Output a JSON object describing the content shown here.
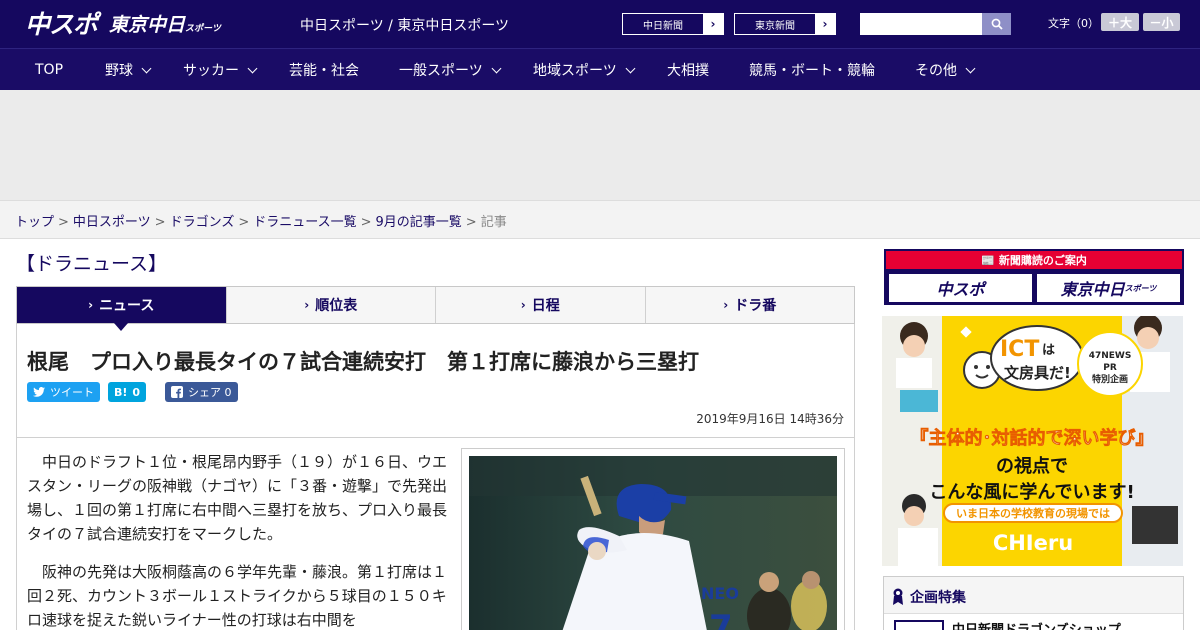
{
  "header": {
    "logo_main": "中スポ",
    "logo_sub": "東京中日",
    "logo_sub_small": "スポーツ",
    "site_title": "中日スポーツ / 東京中日スポーツ",
    "paper_links": [
      "中日新聞",
      "東京新聞"
    ],
    "search_placeholder": "",
    "font_size_label": "文字（0）",
    "font_bigger": "＋大",
    "font_smaller": "－小"
  },
  "nav": [
    {
      "label": "TOP",
      "dropdown": false
    },
    {
      "label": "野球",
      "dropdown": true
    },
    {
      "label": "サッカー",
      "dropdown": true
    },
    {
      "label": "芸能・社会",
      "dropdown": false
    },
    {
      "label": "一般スポーツ",
      "dropdown": true
    },
    {
      "label": "地域スポーツ",
      "dropdown": true
    },
    {
      "label": "大相撲",
      "dropdown": false
    },
    {
      "label": "競馬・ボート・競輪",
      "dropdown": false
    },
    {
      "label": "その他",
      "dropdown": true
    }
  ],
  "breadcrumb": {
    "items": [
      "トップ",
      "中日スポーツ",
      "ドラゴンズ",
      "ドラニュース一覧",
      "9月の記事一覧"
    ],
    "current": "記事"
  },
  "section_title": "【ドラニュース】",
  "tabs": [
    {
      "label": "ニュース",
      "active": true
    },
    {
      "label": "順位表",
      "active": false
    },
    {
      "label": "日程",
      "active": false
    },
    {
      "label": "ドラ番",
      "active": false
    }
  ],
  "article": {
    "headline": "根尾　プロ入り最長タイの７試合連続安打　第１打席に藤浪から三塁打",
    "share": {
      "tweet": "ツイート",
      "hatena_count": "0",
      "facebook": "シェア 0"
    },
    "date": "2019年9月16日 14時36分",
    "paragraphs": [
      "中日のドラフト１位・根尾昂内野手（１９）が１６日、ウエスタン・リーグの阪神戦（ナゴヤ）に「３番・遊撃」で先発出場し、１回の第１打席に右中間へ三塁打を放ち、プロ入り最長タイの７試合連続安打をマークした。",
      "阪神の先発は大阪桐蔭高の６学年先輩・藤浪。第１打席は１回２死、カウント３ボール１ストライクから５球目の１５０キロ速球を捉えた鋭いライナー性の打球は右中間を"
    ],
    "photo_jersey": "NEO"
  },
  "sidebar": {
    "subscribe_head": "新聞購読のご案内",
    "subscribe_logos": [
      "中スポ",
      "東京中日"
    ],
    "subscribe_logo_small": "スポーツ",
    "ict": {
      "bubble_1": "ICT",
      "bubble_2": "は",
      "bubble_3": "文房具だ!",
      "badge_1": "47NEWS",
      "badge_2": "PR",
      "badge_3": "特別企画",
      "line_1": "『主体的･対話的で深い学び』",
      "line_2": "の視点で",
      "line_3": "こんな風に学んでいます!",
      "ribbon": "いま日本の学校教育の現場では",
      "brand": "CHIeru"
    },
    "feature_title": "企画特集",
    "feature_item": "中日新聞ドラゴンズショップ"
  },
  "colors": {
    "brand_navy": "#15085f",
    "accent_red": "#e60033",
    "twitter": "#1da1f2",
    "hatena": "#00a4de",
    "facebook": "#3b5998",
    "banner_yellow": "#fcd500"
  }
}
